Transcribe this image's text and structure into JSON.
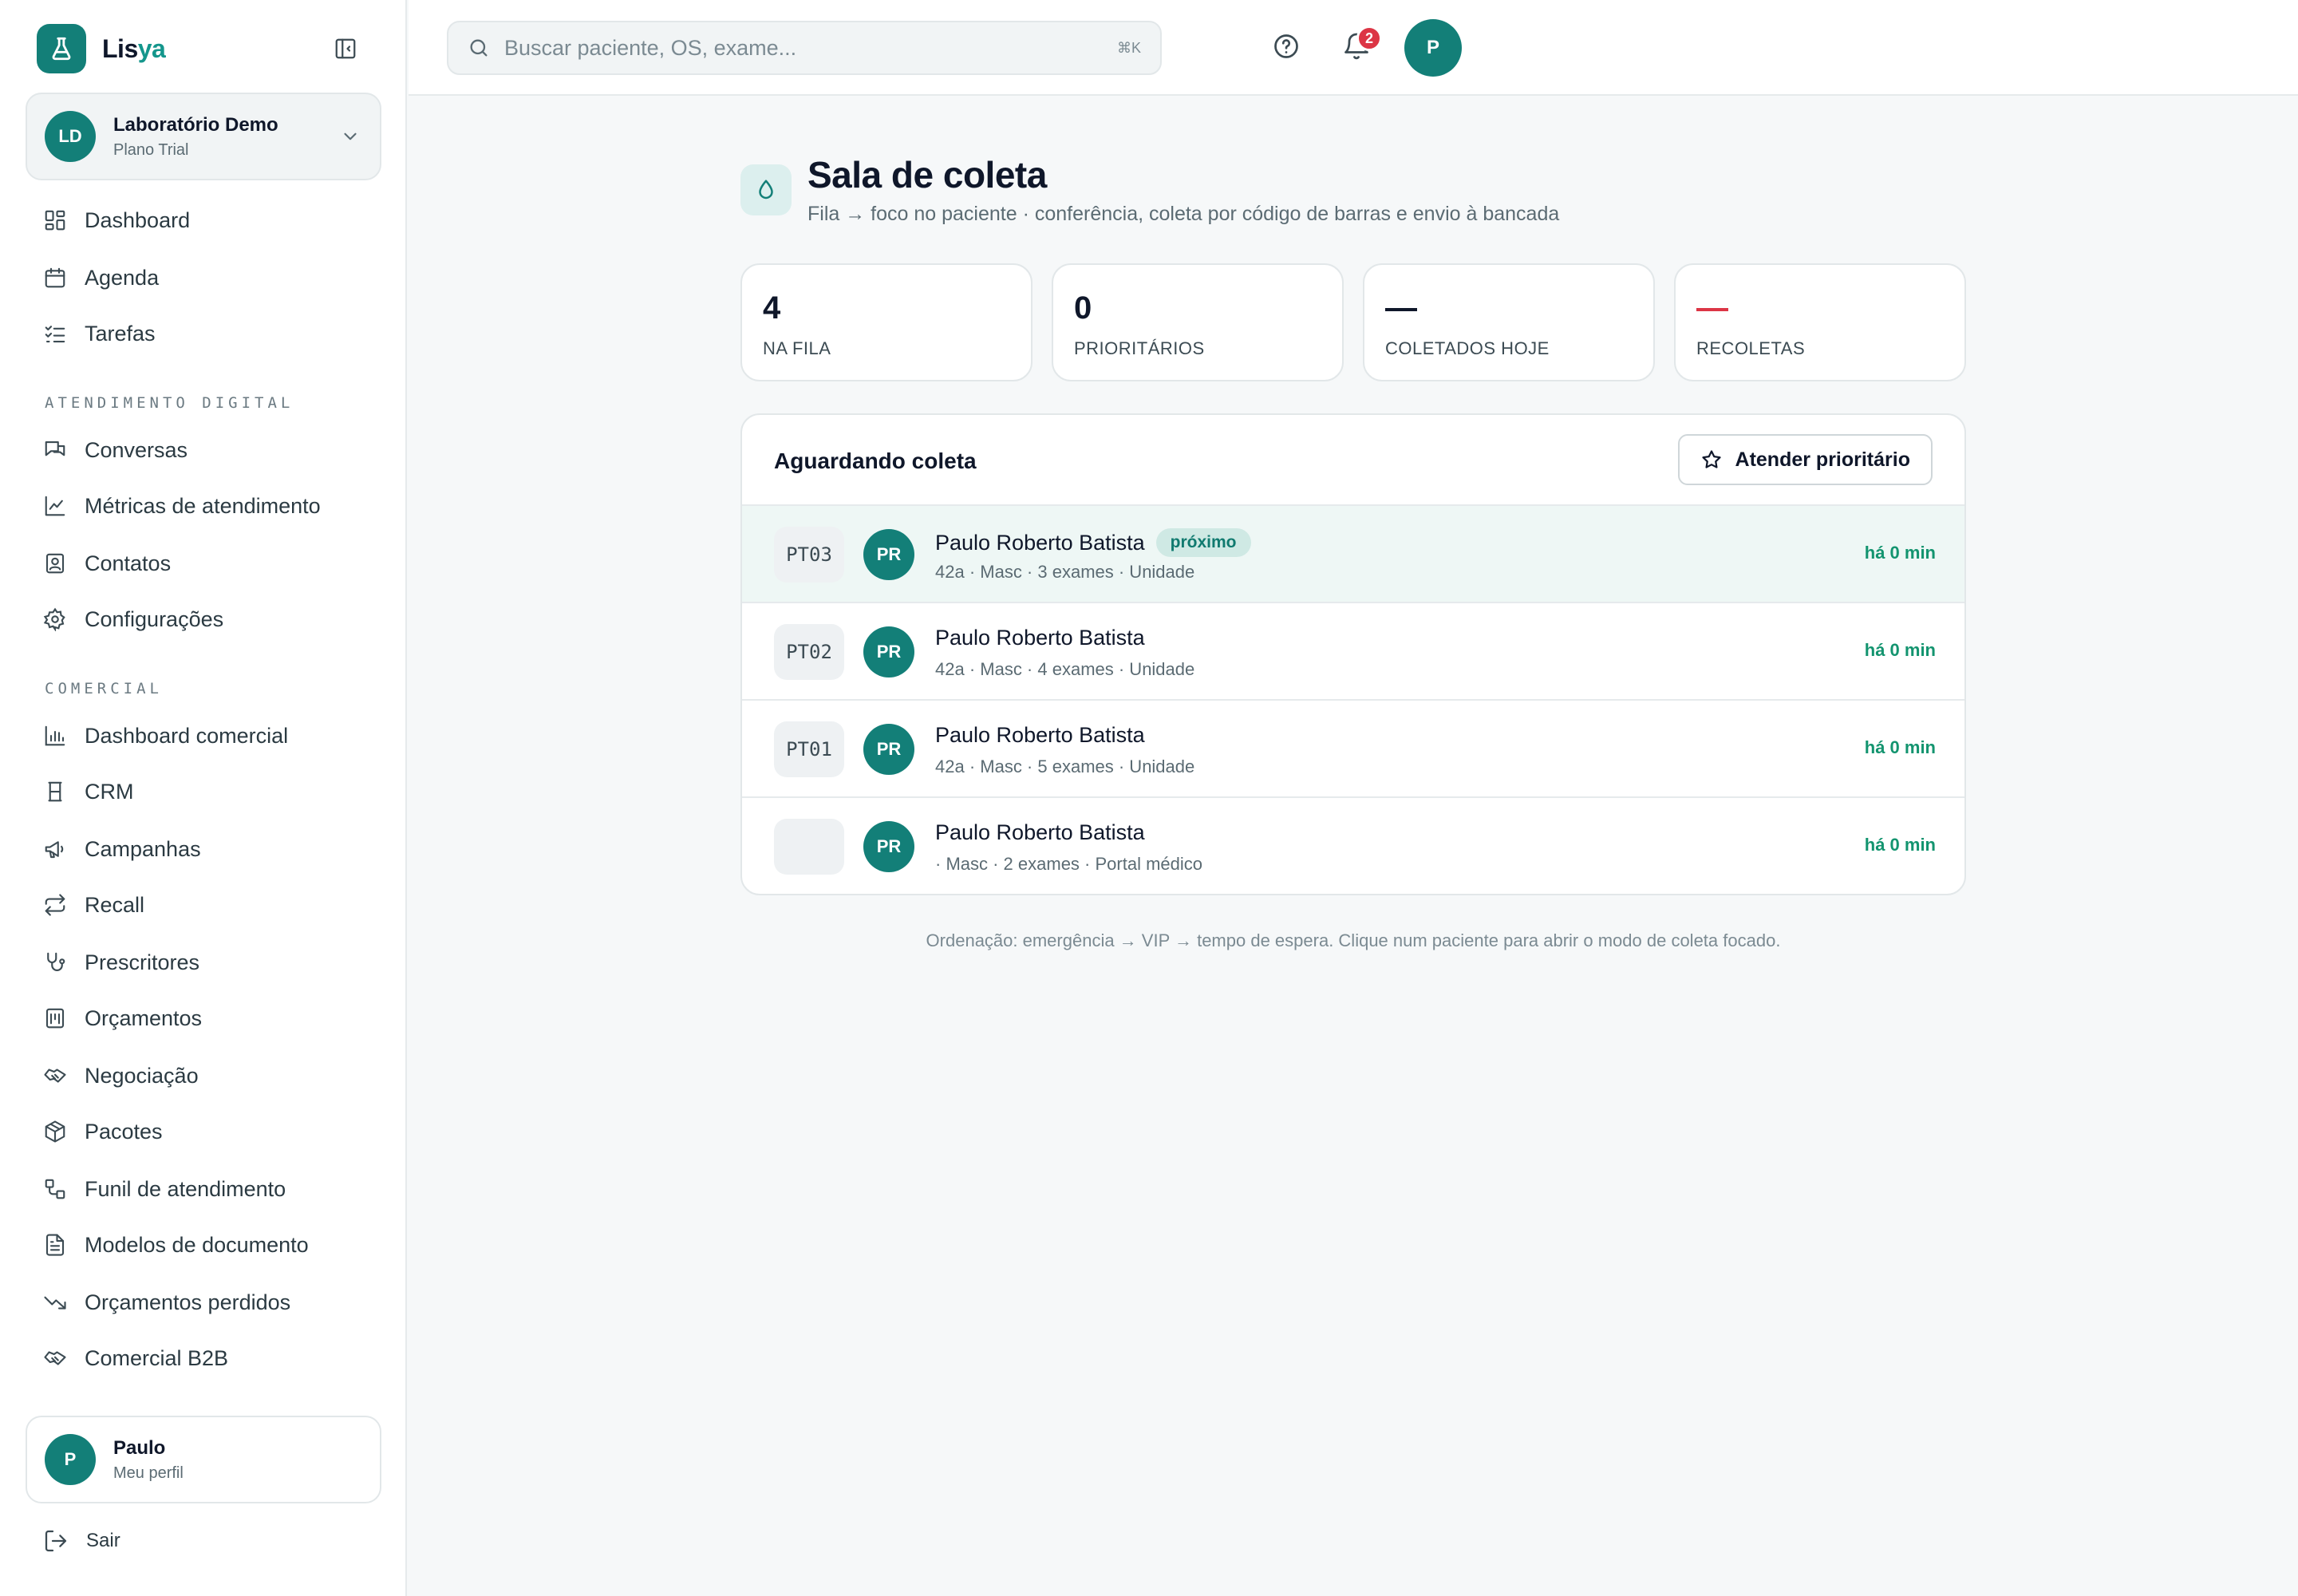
{
  "brand": {
    "name_main": "Lis",
    "name_accent": "ya"
  },
  "org": {
    "initials": "LD",
    "name": "Laboratório Demo",
    "plan": "Plano Trial"
  },
  "nav": {
    "main": [
      {
        "label": "Dashboard",
        "icon": "dashboard-icon"
      },
      {
        "label": "Agenda",
        "icon": "calendar-icon"
      },
      {
        "label": "Tarefas",
        "icon": "tasks-icon"
      }
    ],
    "section_digital": "ATENDIMENTO DIGITAL",
    "digital": [
      {
        "label": "Conversas",
        "icon": "chat-icon"
      },
      {
        "label": "Métricas de atendimento",
        "icon": "line-chart-icon"
      },
      {
        "label": "Contatos",
        "icon": "contacts-icon"
      },
      {
        "label": "Configurações",
        "icon": "gear-icon"
      }
    ],
    "section_comercial": "COMERCIAL",
    "comercial": [
      {
        "label": "Dashboard comercial",
        "icon": "bar-chart-icon"
      },
      {
        "label": "CRM",
        "icon": "crm-icon"
      },
      {
        "label": "Campanhas",
        "icon": "megaphone-icon"
      },
      {
        "label": "Recall",
        "icon": "repeat-icon"
      },
      {
        "label": "Prescritores",
        "icon": "stethoscope-icon"
      },
      {
        "label": "Orçamentos",
        "icon": "calculator-icon"
      },
      {
        "label": "Negociação",
        "icon": "handshake-icon"
      },
      {
        "label": "Pacotes",
        "icon": "package-icon"
      },
      {
        "label": "Funil de atendimento",
        "icon": "workflow-icon"
      },
      {
        "label": "Modelos de documento",
        "icon": "document-icon"
      },
      {
        "label": "Orçamentos perdidos",
        "icon": "trending-down-icon"
      },
      {
        "label": "Comercial B2B",
        "icon": "handshake-icon"
      }
    ]
  },
  "profile": {
    "initial": "P",
    "name": "Paulo",
    "sub": "Meu perfil"
  },
  "logout_label": "Sair",
  "search": {
    "placeholder": "Buscar paciente, OS, exame...",
    "shortcut": "⌘K"
  },
  "notifications": {
    "count": "2"
  },
  "user": {
    "initial": "P"
  },
  "page": {
    "title": "Sala de coleta",
    "subtitle": "Fila → foco no paciente · conferência, coleta por código de barras e envio à bancada"
  },
  "stats": [
    {
      "value": "4",
      "label": "NA FILA"
    },
    {
      "value": "0",
      "label": "PRIORITÁRIOS"
    },
    {
      "value": "—",
      "label": "COLETADOS HOJE",
      "color": "#0f172a"
    },
    {
      "value": "—",
      "label": "RECOLETAS",
      "color": "#dc3545"
    }
  ],
  "queue": {
    "title": "Aguardando coleta",
    "priority_button": "Atender prioritário",
    "rows": [
      {
        "code": "PT03",
        "initials": "PR",
        "name": "Paulo Roberto Batista",
        "tag": "próximo",
        "meta": "42a · Masc · 3 exames · Unidade",
        "time": "há 0 min"
      },
      {
        "code": "PT02",
        "initials": "PR",
        "name": "Paulo Roberto Batista",
        "tag": "",
        "meta": "42a · Masc · 4 exames · Unidade",
        "time": "há 0 min"
      },
      {
        "code": "PT01",
        "initials": "PR",
        "name": "Paulo Roberto Batista",
        "tag": "",
        "meta": "42a · Masc · 5 exames · Unidade",
        "time": "há 0 min"
      },
      {
        "code": "",
        "initials": "PR",
        "name": "Paulo Roberto Batista",
        "tag": "",
        "meta": "· Masc · 2 exames · Portal médico",
        "time": "há 0 min"
      }
    ]
  },
  "footnote": "Ordenação: emergência → VIP → tempo de espera. Clique num paciente para abrir o modo de coleta focado.",
  "colors": {
    "primary": "#137f78",
    "accent": "#14968c",
    "danger": "#dc3545",
    "success": "#13946f"
  }
}
